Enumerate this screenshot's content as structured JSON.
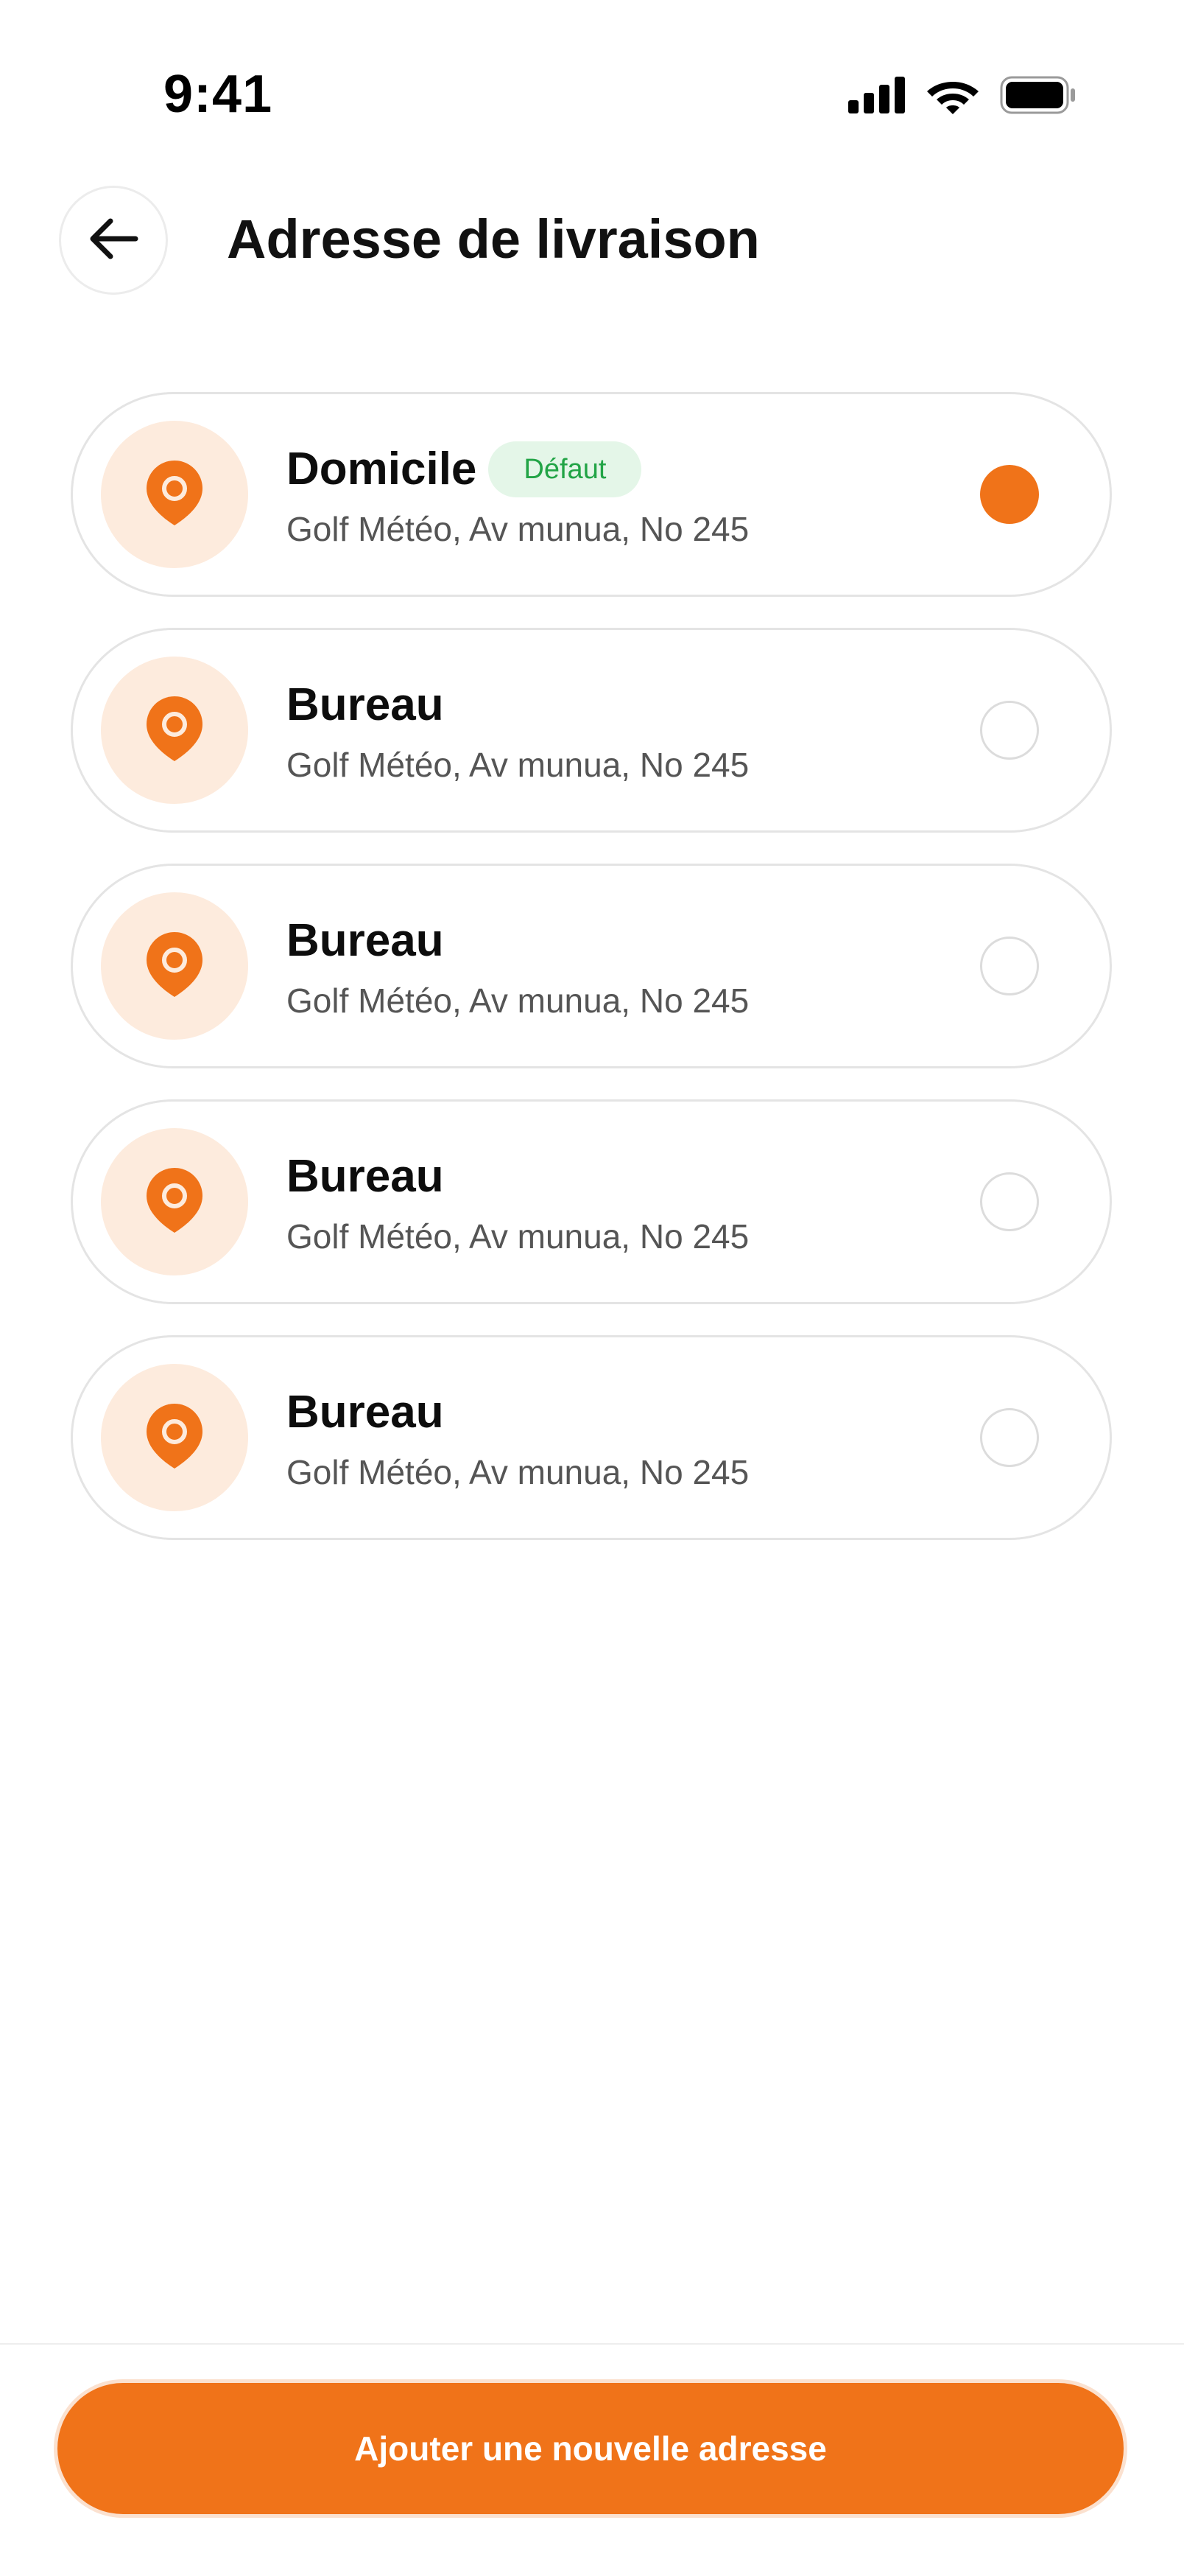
{
  "status_bar": {
    "time": "9:41"
  },
  "header": {
    "title": "Adresse de livraison"
  },
  "colors": {
    "accent": "#f07319",
    "pin_background": "#fdebdd",
    "badge_background": "#e4f6e8",
    "badge_text": "#22a446"
  },
  "addresses": [
    {
      "name": "Domicile",
      "badge": "Défaut",
      "line": "Golf Météo, Av munua, No 245",
      "selected": true,
      "icon": "location-pin-icon"
    },
    {
      "name": "Bureau",
      "line": "Golf Météo, Av munua, No 245",
      "selected": false,
      "icon": "location-pin-icon"
    },
    {
      "name": "Bureau",
      "line": "Golf Météo, Av munua, No 245",
      "selected": false,
      "icon": "location-pin-icon"
    },
    {
      "name": "Bureau",
      "line": "Golf Météo, Av munua, No 245",
      "selected": false,
      "icon": "location-pin-icon"
    },
    {
      "name": "Bureau",
      "line": "Golf Météo, Av munua, No 245",
      "selected": false,
      "icon": "location-pin-icon"
    }
  ],
  "footer": {
    "add_button_label": "Ajouter une nouvelle adresse"
  }
}
